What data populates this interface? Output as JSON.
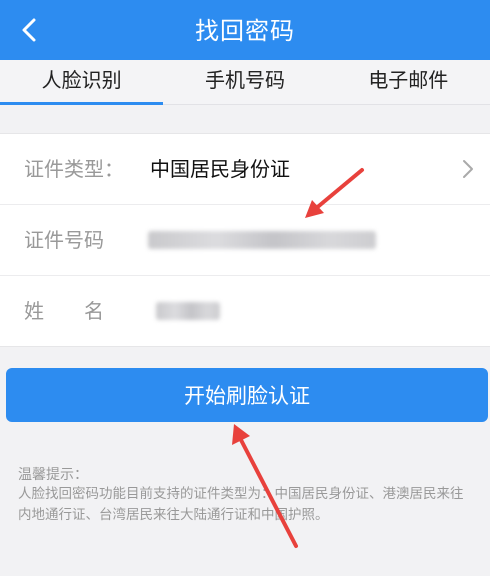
{
  "header": {
    "title": "找回密码",
    "back_icon": "chevron-left-icon",
    "color": "#2d8cf0"
  },
  "tabs": [
    {
      "label": "人脸识别",
      "active": true
    },
    {
      "label": "手机号码",
      "active": false
    },
    {
      "label": "电子邮件",
      "active": false
    }
  ],
  "form": {
    "id_type": {
      "label": "证件类型：",
      "value": "中国居民身份证",
      "icon": "chevron-right-icon"
    },
    "id_number": {
      "label": "证件号码"
    },
    "name": {
      "label": "姓　　名"
    }
  },
  "action": {
    "label": "开始刷脸认证"
  },
  "tip": {
    "title": "温馨提示：",
    "body": "人脸找回密码功能目前支持的证件类型为：中国居民身份证、港澳居民来往内地通行证、台湾居民来往大陆通行证和中国护照。"
  },
  "annotation_color": "#e8413c"
}
